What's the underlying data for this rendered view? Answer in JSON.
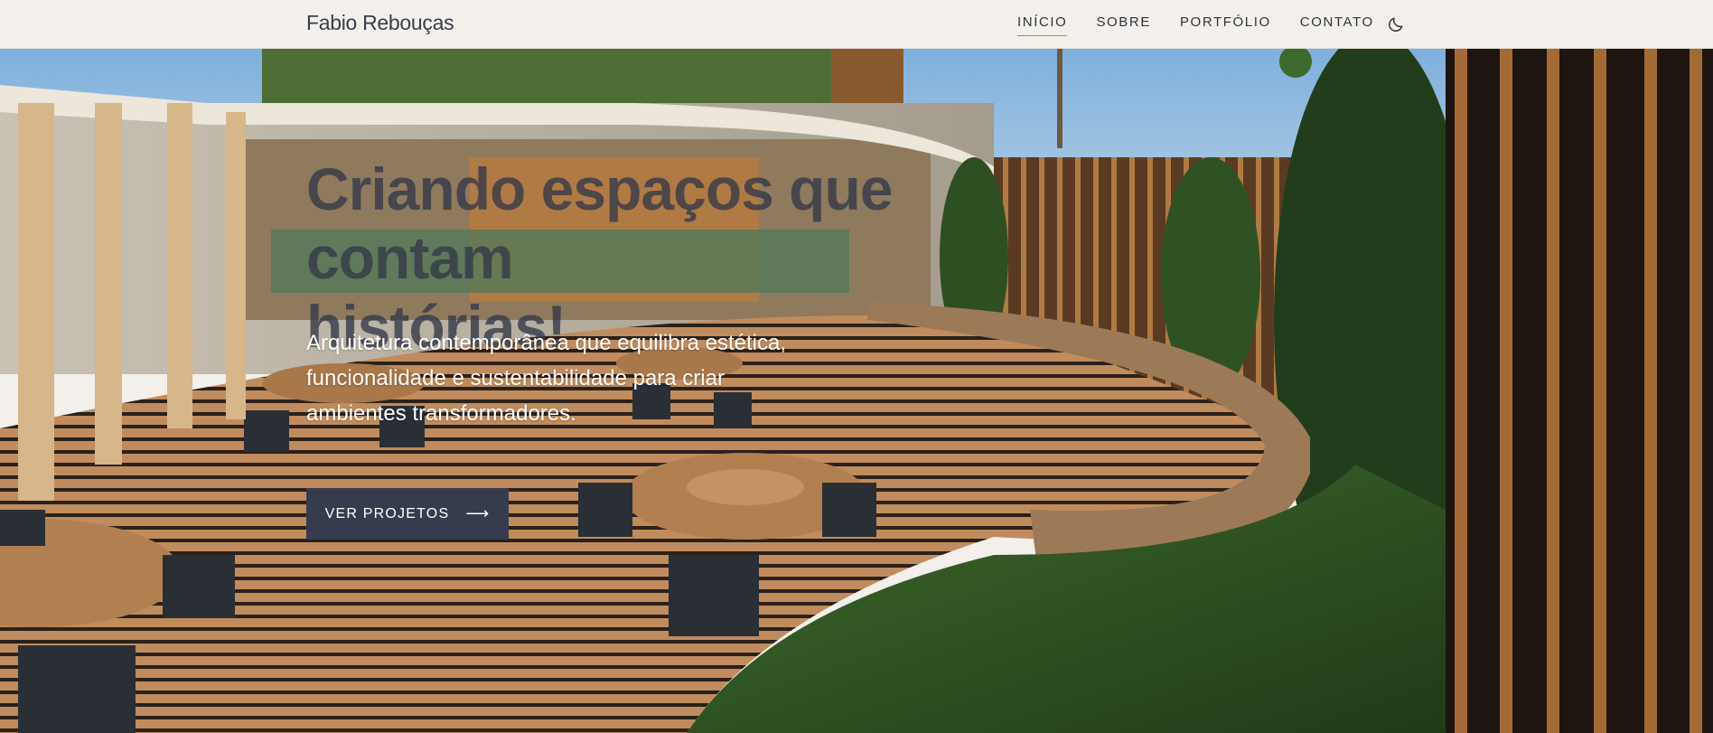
{
  "header": {
    "brand": "Fabio Rebouças",
    "nav": [
      {
        "label": "INÍCIO",
        "active": true
      },
      {
        "label": "SOBRE",
        "active": false
      },
      {
        "label": "PORTFÓLIO",
        "active": false
      },
      {
        "label": "CONTATO",
        "active": false
      }
    ],
    "theme_toggle_icon": "moon-icon"
  },
  "hero": {
    "title_line1": "Criando espaços que contam",
    "title_line2": "histórias!",
    "subtitle_line1": "Arquitetura contemporânea que equilibra estética,",
    "subtitle_line2": "funcionalidade e sustentabilidade para criar",
    "subtitle_line3": "ambientes transformadores.",
    "cta_label": "VER PROJETOS",
    "cta_icon": "arrow-right-icon",
    "background_image": "outdoor-deck-with-tables-photo"
  },
  "colors": {
    "header_bg": "#f3f0eb",
    "brand_text": "#3a3e4c",
    "accent_underline": "#b8874a",
    "button_bg": "#363c4e",
    "title_text": "#333848"
  }
}
